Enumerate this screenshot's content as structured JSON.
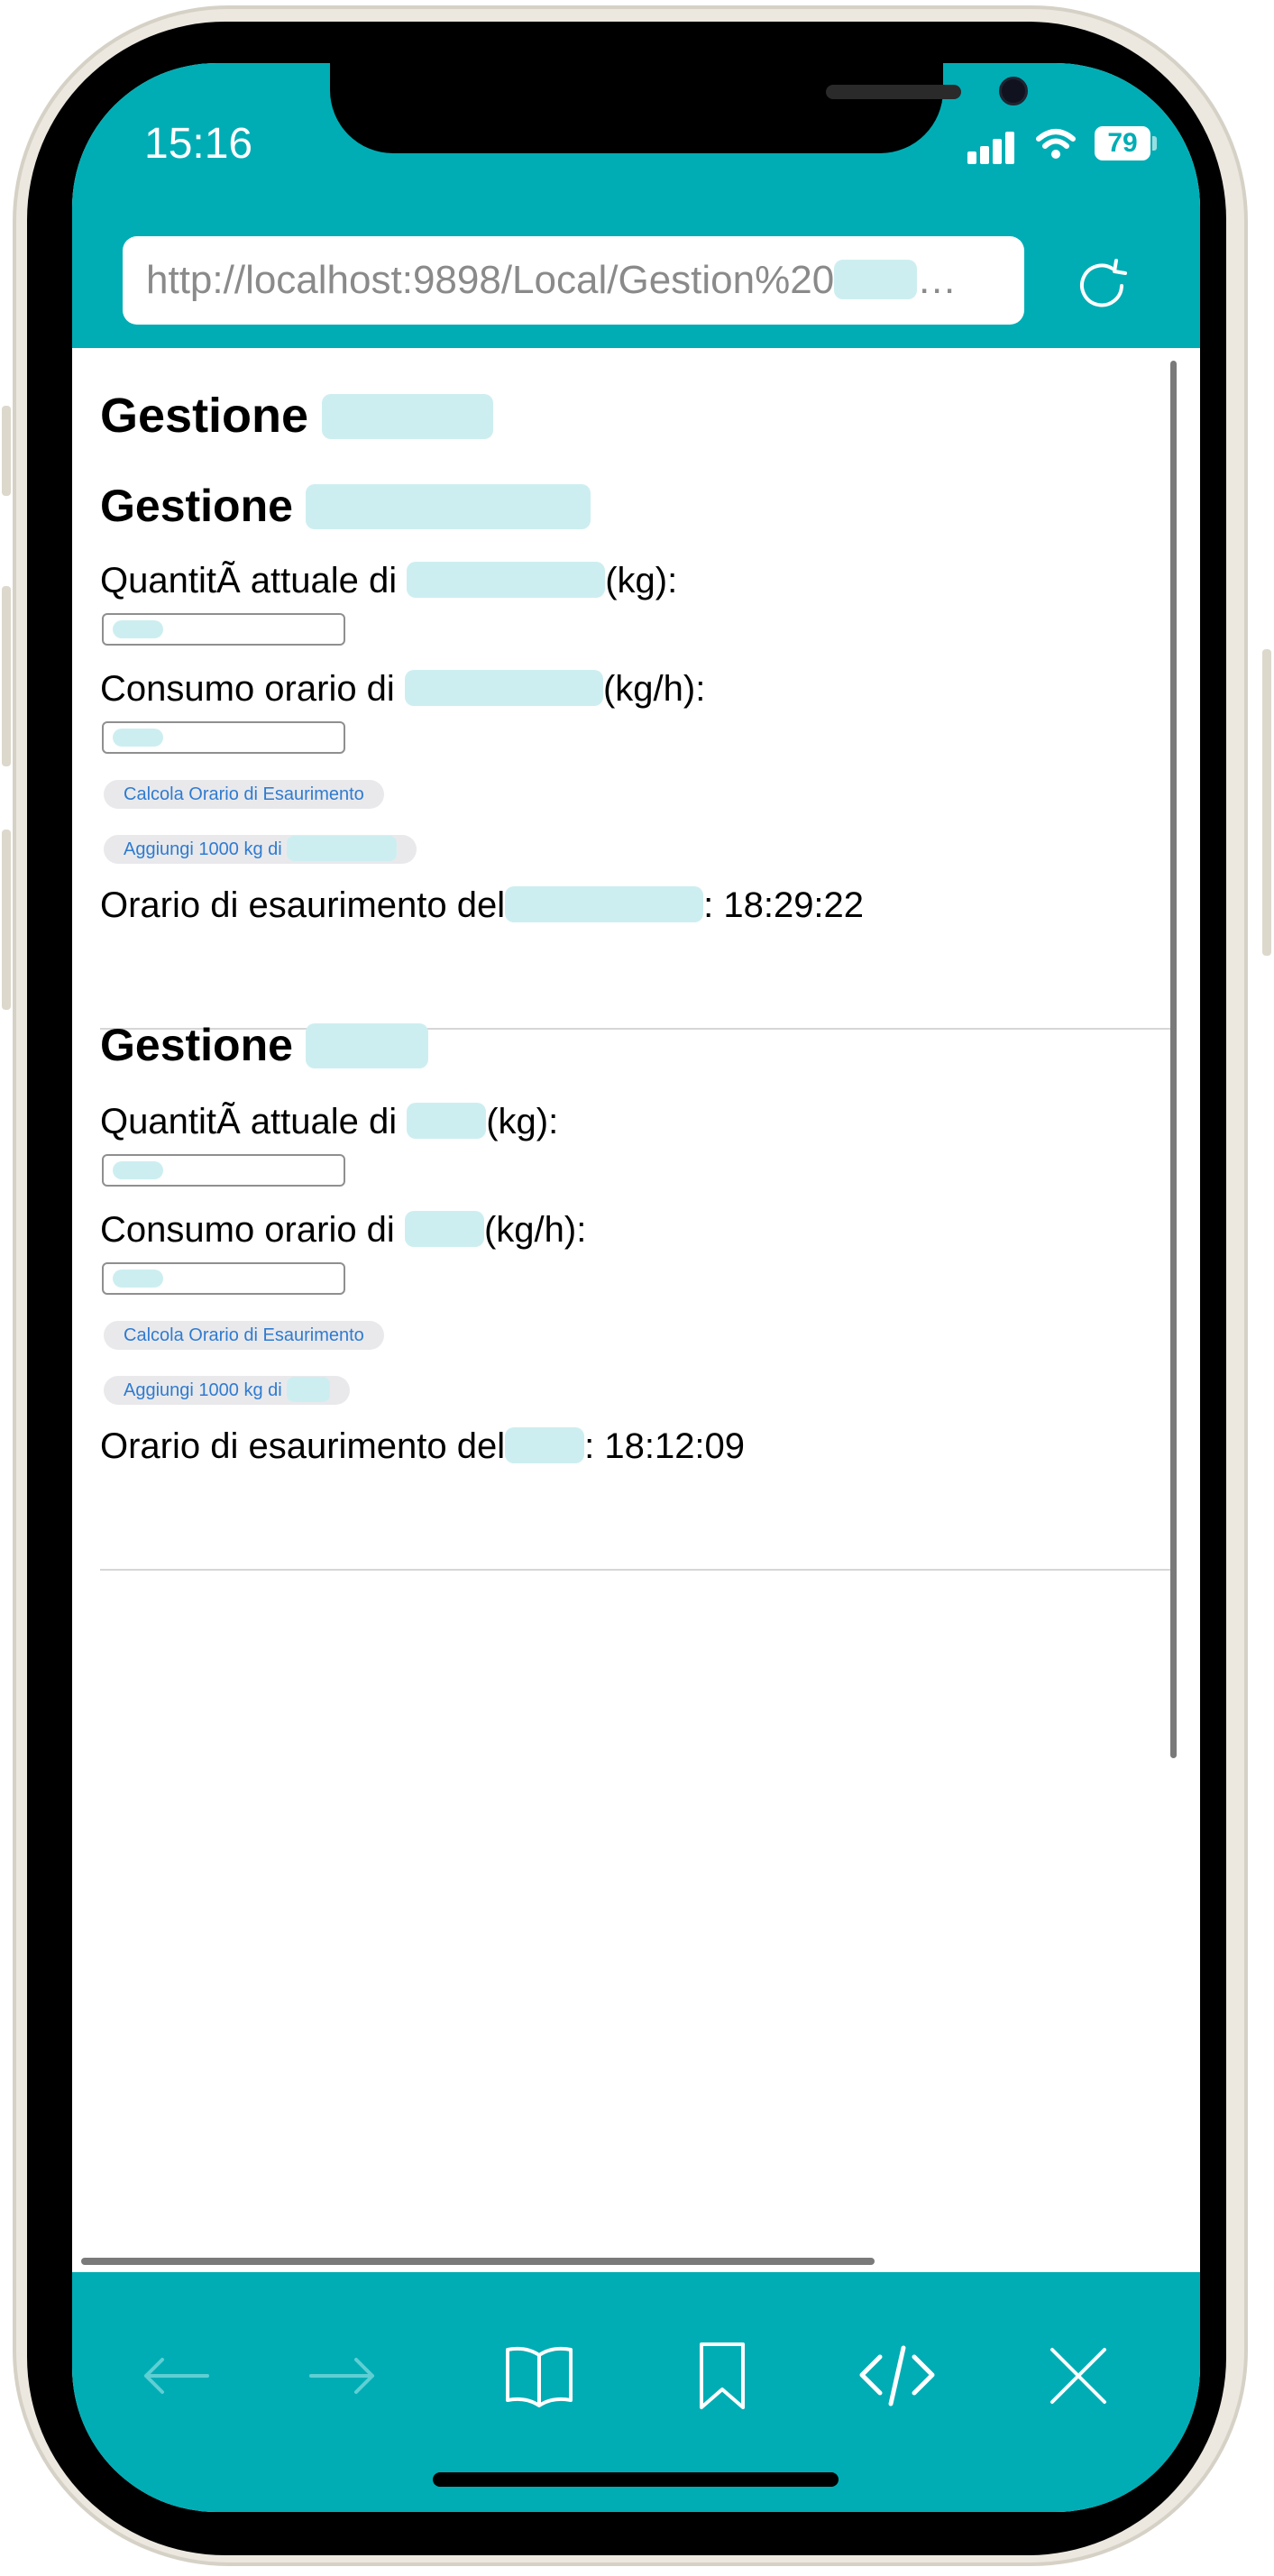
{
  "status_bar": {
    "time": "15:16",
    "battery": "79"
  },
  "browser": {
    "url": "http://localhost:9898/Local/Gestion%20",
    "url_ellipsis": "…"
  },
  "page": {
    "title": "Gestione",
    "sections": [
      {
        "heading": "Gestione",
        "quantity_label_pre": "QuantitÃ  attuale di",
        "quantity_label_post": "(kg):",
        "consumption_label_pre": "Consumo orario di",
        "consumption_label_post": "(kg/h):",
        "calc_button": "Calcola Orario di Esaurimento",
        "add_button": "Aggiungi 1000 kg di",
        "result_pre": "Orario di esaurimento del",
        "result_post": ": 18:29:22"
      },
      {
        "heading": "Gestione",
        "quantity_label_pre": "QuantitÃ  attuale di",
        "quantity_label_post": "(kg):",
        "consumption_label_pre": "Consumo orario di",
        "consumption_label_post": "(kg/h):",
        "calc_button": "Calcola Orario di Esaurimento",
        "add_button": "Aggiungi 1000 kg di",
        "result_pre": "Orario di esaurimento del",
        "result_post": ": 18:12:09"
      }
    ]
  },
  "toolbar": {
    "items": [
      "back-arrow-icon",
      "forward-arrow-icon",
      "book-icon",
      "bookmark-icon",
      "code-icon",
      "close-icon"
    ]
  },
  "colors": {
    "brand": "#00adb5",
    "redaction": "#cdeef0",
    "button_text": "#2f7bd0"
  }
}
